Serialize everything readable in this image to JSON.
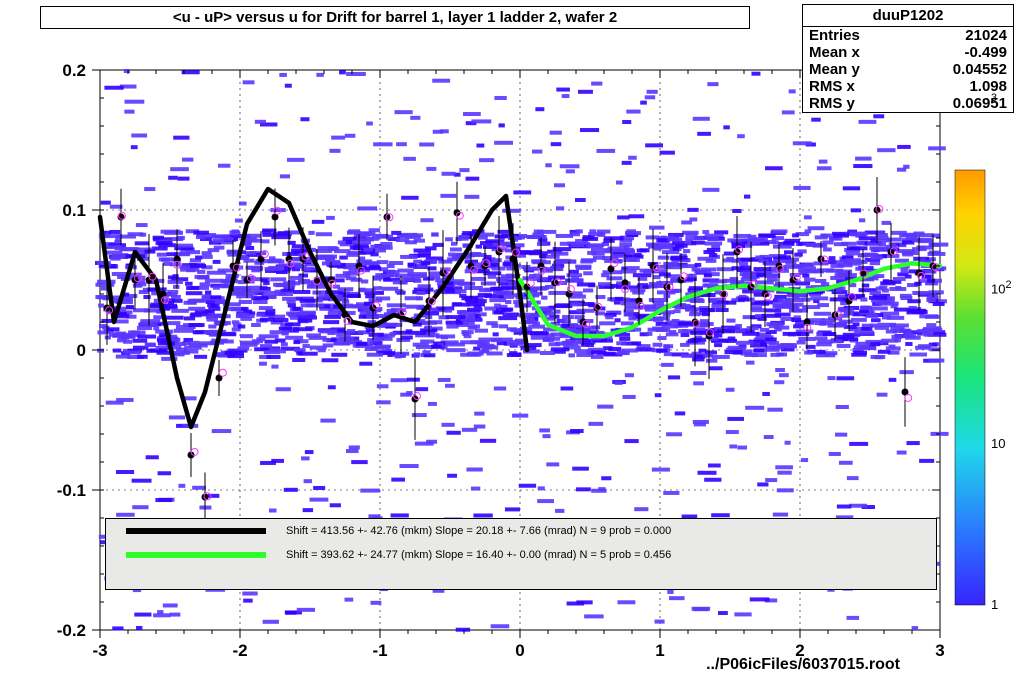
{
  "chart_data": {
    "type": "scatter",
    "title": "<u - uP>       versus   u for Drift for barrel 1, layer 1 ladder 2, wafer 2",
    "xlabel": "",
    "ylabel": "",
    "xlim": [
      -3,
      3
    ],
    "ylim": [
      -0.2,
      0.2
    ],
    "x_ticks": [
      -3,
      -2,
      -1,
      0,
      1,
      2,
      3
    ],
    "y_ticks": [
      -0.2,
      -0.1,
      0,
      0.1,
      0.2
    ],
    "colorbar": {
      "scale": "log",
      "ticks": [
        1,
        10,
        100,
        1000
      ]
    },
    "series": [
      {
        "name": "Black curve",
        "type": "line",
        "x": [
          -3.0,
          -2.9,
          -2.75,
          -2.6,
          -2.45,
          -2.35,
          -2.25,
          -2.1,
          -1.95,
          -1.8,
          -1.65,
          -1.5,
          -1.35,
          -1.2,
          -1.05,
          -0.9,
          -0.75,
          -0.55,
          -0.35,
          -0.2,
          -0.1,
          0.0,
          0.05
        ],
        "y": [
          0.095,
          0.02,
          0.07,
          0.05,
          -0.02,
          -0.055,
          -0.03,
          0.03,
          0.09,
          0.115,
          0.105,
          0.07,
          0.04,
          0.02,
          0.017,
          0.025,
          0.02,
          0.045,
          0.075,
          0.1,
          0.11,
          0.04,
          0.0
        ],
        "color": "#000000",
        "legend": "Shift =   413.56 +- 42.76 (mkm) Slope =   20.18 +- 7.66 (mrad)  N = 9 prob = 0.000"
      },
      {
        "name": "Green curve",
        "type": "line",
        "x": [
          0.0,
          0.2,
          0.4,
          0.6,
          0.8,
          1.0,
          1.2,
          1.4,
          1.6,
          1.8,
          2.0,
          2.2,
          2.4,
          2.6,
          2.8,
          3.0
        ],
        "y": [
          0.05,
          0.018,
          0.01,
          0.01,
          0.016,
          0.028,
          0.038,
          0.044,
          0.046,
          0.044,
          0.042,
          0.044,
          0.05,
          0.058,
          0.062,
          0.06
        ],
        "color": "#2cff2c",
        "legend": "Shift =   393.62 +- 24.77 (mkm) Slope =   16.40 +- 0.00 (mrad)  N = 5 prob = 0.456"
      },
      {
        "name": "Black points",
        "type": "scatter",
        "x": [
          -2.95,
          -2.85,
          -2.75,
          -2.65,
          -2.55,
          -2.45,
          -2.35,
          -2.25,
          -2.15,
          -2.05,
          -1.95,
          -1.85,
          -1.75,
          -1.65,
          -1.55,
          -1.45,
          -1.35,
          -1.25,
          -1.15,
          -1.05,
          -0.95,
          -0.85,
          -0.75,
          -0.65,
          -0.55,
          -0.45,
          -0.35,
          -0.25,
          -0.15,
          -0.05,
          0.05,
          0.15,
          0.25,
          0.35,
          0.45,
          0.55,
          0.65,
          0.75,
          0.85,
          0.95,
          1.05,
          1.15,
          1.25,
          1.35,
          1.45,
          1.55,
          1.65,
          1.75,
          1.85,
          1.95,
          2.05,
          2.15,
          2.25,
          2.35,
          2.45,
          2.55,
          2.65,
          2.75,
          2.85,
          2.95
        ],
        "y": [
          0.03,
          0.095,
          0.05,
          0.05,
          0.04,
          0.065,
          -0.075,
          -0.105,
          -0.02,
          0.06,
          0.05,
          0.065,
          0.095,
          0.065,
          0.065,
          0.05,
          0.05,
          0.025,
          0.06,
          0.03,
          0.095,
          0.025,
          -0.035,
          0.035,
          0.055,
          0.098,
          0.06,
          0.06,
          0.07,
          0.065,
          0.045,
          0.06,
          0.048,
          0.04,
          0.02,
          0.03,
          0.058,
          0.048,
          0.035,
          0.06,
          0.045,
          0.05,
          0.02,
          0.01,
          0.04,
          0.07,
          0.045,
          0.04,
          0.06,
          0.05,
          0.02,
          0.065,
          0.025,
          0.035,
          0.055,
          0.1,
          0.07,
          -0.03,
          0.055,
          0.06
        ],
        "color": "#000000"
      }
    ],
    "density_notes": "Background shows a 2D histogram (blue/purple heatmap) of counts with log color scale 1..~1000."
  },
  "stats": {
    "name": "duuP1202",
    "rows": [
      {
        "label": "Entries",
        "value": "21024"
      },
      {
        "label": "Mean x",
        "value": "-0.499"
      },
      {
        "label": "Mean y",
        "value": "0.04552"
      },
      {
        "label": "RMS x",
        "value": "1.098"
      },
      {
        "label": "RMS y",
        "value": "0.06951"
      }
    ]
  },
  "legend": {
    "rows": [
      {
        "color": "#000000",
        "text": "Shift =   413.56 +- 42.76 (mkm) Slope =   20.18 +- 7.66 (mrad)  N = 9 prob = 0.000"
      },
      {
        "color": "#2cff2c",
        "text": "Shift =   393.62 +- 24.77 (mkm) Slope =   16.40 +- 0.00 (mrad)  N = 5 prob = 0.456"
      }
    ]
  },
  "colorbar_labels": {
    "t1000": "3",
    "t100": "10",
    "t10": "10",
    "t1": "1",
    "sup2": "2",
    "prefix10": "10"
  },
  "file_path": "../P06icFiles/6037015.root"
}
